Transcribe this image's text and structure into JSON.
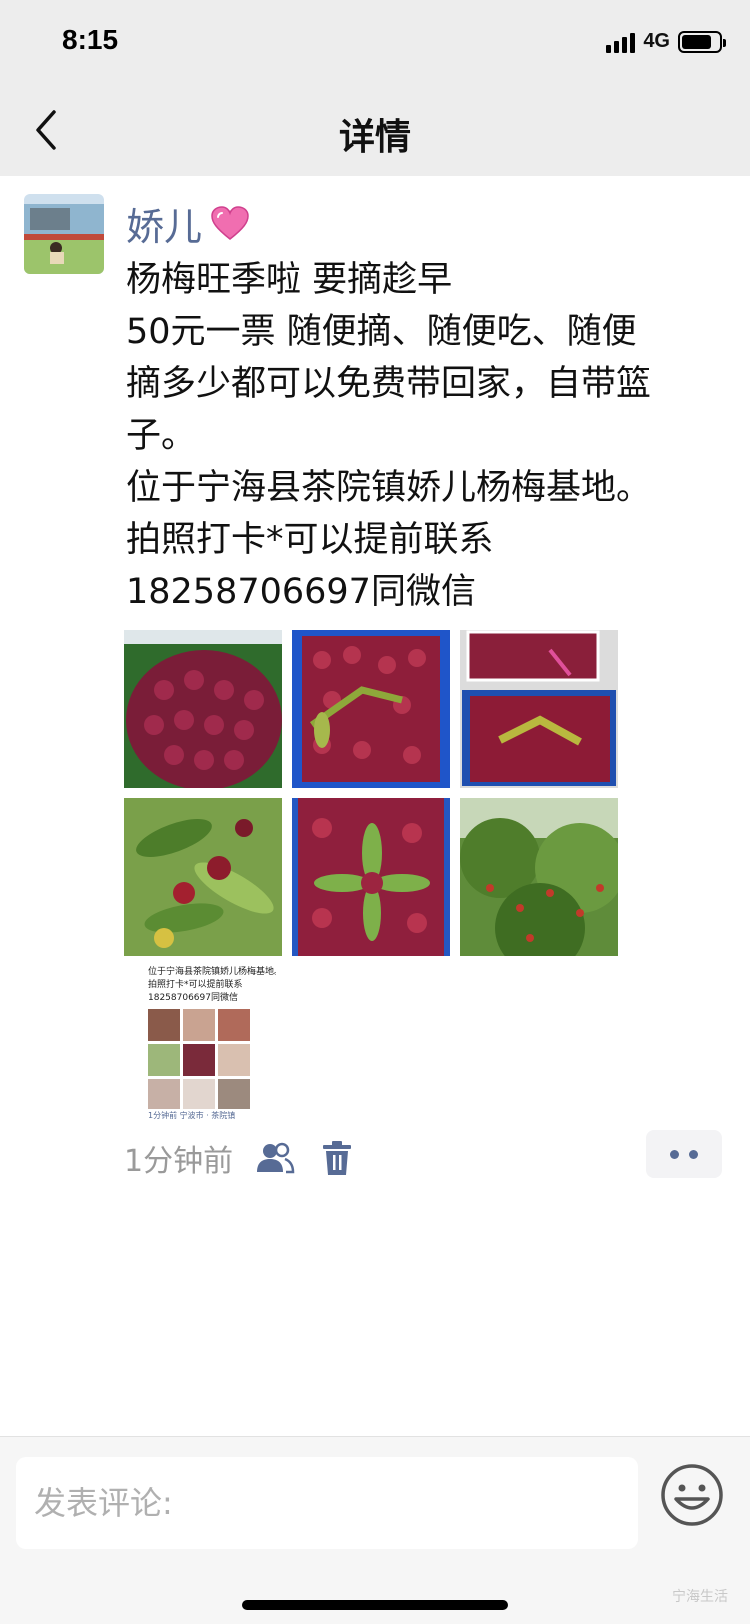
{
  "status_bar": {
    "time": "8:15",
    "network": "4G"
  },
  "nav": {
    "title": "详情"
  },
  "post": {
    "author": "娇儿",
    "lines": [
      "杨梅旺季啦  要摘趁早",
      "50元一票 随便摘、随便吃、随便",
      "摘多少都可以免费带回家，自带篮",
      "子。",
      "位于宁海县茶院镇娇儿杨梅基地。",
      "拍照打卡*可以提前联系",
      "18258706697同微信"
    ],
    "screenshot_lines": [
      "位于宁海县茶院镇娇儿杨梅基地。",
      "拍照打卡*可以提前联系",
      "18258706697同微信"
    ],
    "screenshot_footer": "1分钟前  宁波市 · 茶院镇",
    "time": "1分钟前"
  },
  "comment": {
    "placeholder": "发表评论:"
  },
  "watermark": "宁海生活"
}
